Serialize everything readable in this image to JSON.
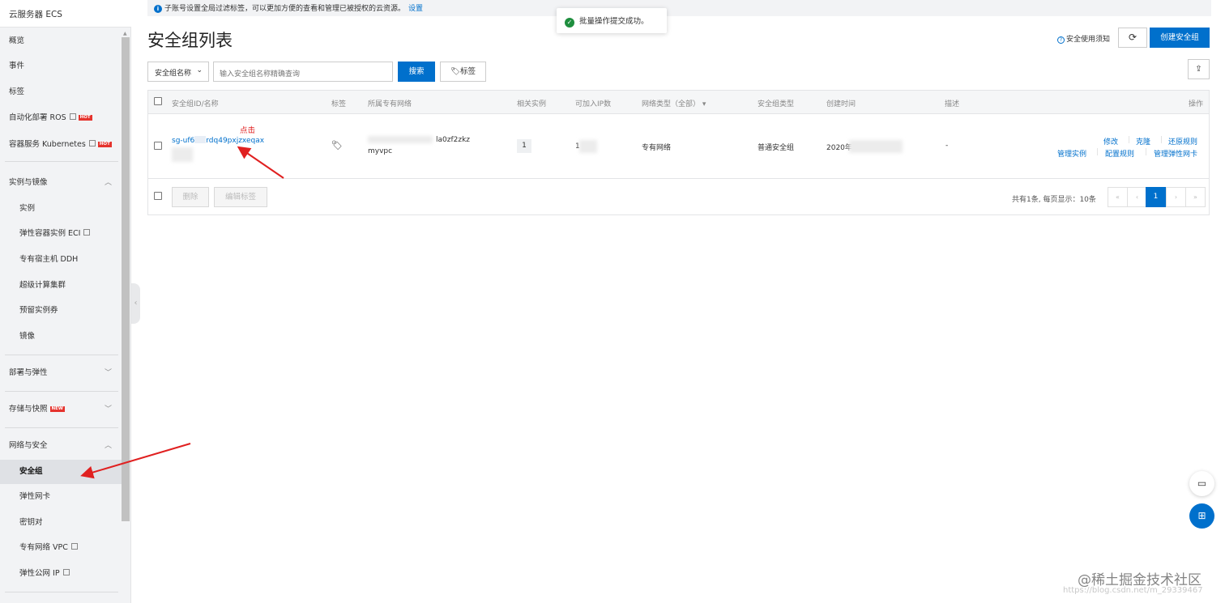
{
  "sidebar": {
    "title": "云服务器 ECS",
    "items": [
      {
        "label": "概览"
      },
      {
        "label": "事件"
      },
      {
        "label": "标签"
      },
      {
        "label": "自动化部署 ROS",
        "badge": "HOT"
      },
      {
        "label": "容器服务 Kubernetes",
        "badge": "HOT"
      }
    ],
    "groups": [
      {
        "label": "实例与镜像",
        "children": [
          "实例",
          "弹性容器实例 ECI",
          "专有宿主机 DDH",
          "超级计算集群",
          "预留实例券",
          "镜像"
        ]
      },
      {
        "label": "部署与弹性"
      },
      {
        "label": "存储与快照",
        "badge": "NEW"
      },
      {
        "label": "网络与安全",
        "children": [
          "安全组",
          "弹性网卡",
          "密钥对",
          "专有网络 VPC",
          "弹性公网 IP"
        ]
      }
    ]
  },
  "notice": {
    "text": "子账号设置全局过滤标签，可以更加方便的查看和管理已被授权的云资源。",
    "link": "设置"
  },
  "toast": {
    "text": "批量操作提交成功。"
  },
  "page": {
    "title": "安全组列表",
    "help": "安全使用须知",
    "create": "创建安全组"
  },
  "filter": {
    "select": "安全组名称",
    "placeholder": "输入安全组名称精确查询",
    "search": "搜索",
    "tag": "标签"
  },
  "table": {
    "headers": [
      "安全组ID/名称",
      "标签",
      "所属专有网络",
      "相关实例",
      "可加入IP数",
      "网络类型（全部）",
      "安全组类型",
      "创建时间",
      "描述",
      "操作"
    ],
    "row": {
      "id": "sg-uf6",
      "id_tail": "rdq49pxjzxeqax",
      "vpc_id": "la0zf2zkz",
      "vpc_name": "myvpc",
      "instances": "1",
      "ip_count": "1",
      "network": "专有网络",
      "type": "普通安全组",
      "created": "2020年",
      "desc": "-",
      "actions": [
        "修改",
        "克隆",
        "还原规则",
        "管理实例",
        "配置规则",
        "管理弹性网卡"
      ]
    },
    "footer": {
      "delete": "删除",
      "edit_tags": "编辑标签",
      "summary": "共有1条, 每页显示：10条",
      "current_page": "1",
      "pager": [
        "«",
        "‹",
        "›",
        "»"
      ]
    }
  },
  "annotation": {
    "click": "点击"
  },
  "watermark": {
    "main": "@稀土掘金技术社区",
    "sub": "https://blog.csdn.net/m_29339467"
  }
}
